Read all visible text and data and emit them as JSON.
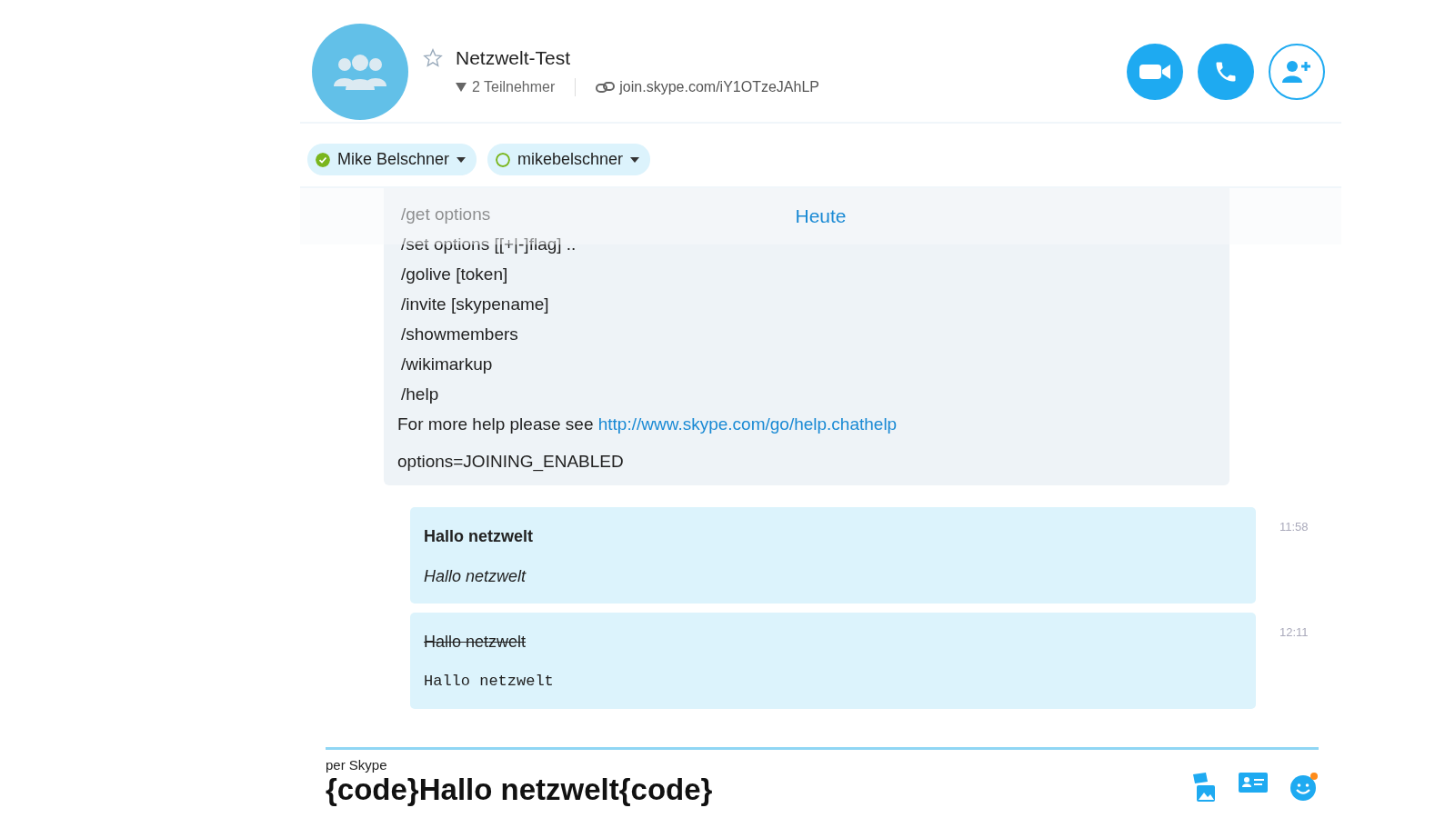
{
  "conversation": {
    "title": "Netzwelt-Test",
    "favorite": false,
    "participants": "2 Teilnehmer",
    "join_link": "join.skype.com/iY1OTzeJAhLP"
  },
  "participants": [
    {
      "name": "Mike Belschner",
      "online": true
    },
    {
      "name": "mikebelschner",
      "online": false
    }
  ],
  "date_divider": "Heute",
  "system_message": {
    "lines": [
      "/get options",
      "/set options [[+|-]flag] ..",
      "/golive [token]",
      "/invite [skypename]",
      "/showmembers",
      "/wikimarkup",
      "/help"
    ],
    "help_text": "For more help please see",
    "help_link": "http://www.skype.com/go/help.chathelp",
    "options": "options=JOINING_ENABLED"
  },
  "messages": [
    {
      "time": "11:58",
      "lines": [
        {
          "kind": "bold",
          "text": "Hallo netzwelt"
        },
        {
          "kind": "italic",
          "text": "Hallo netzwelt"
        }
      ]
    },
    {
      "time": "12:11",
      "lines": [
        {
          "kind": "strike",
          "text": "Hallo netzwelt"
        },
        {
          "kind": "code",
          "text": "Hallo netzwelt"
        }
      ]
    }
  ],
  "composer": {
    "label": "per Skype",
    "value": "{code}Hallo netzwelt{code}"
  }
}
